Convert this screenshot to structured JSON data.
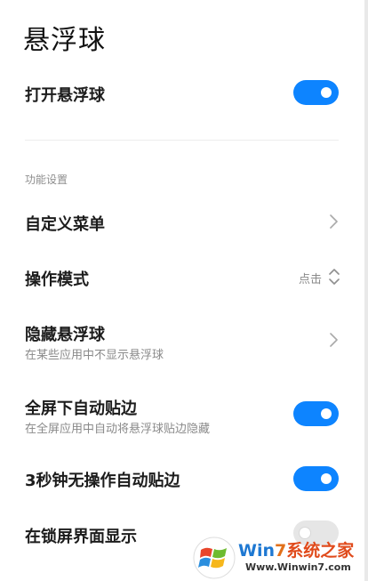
{
  "page": {
    "title": "悬浮球"
  },
  "settings": {
    "enable": {
      "label": "打开悬浮球",
      "enabled": true
    },
    "section_title": "功能设置",
    "custom_menu": {
      "label": "自定义菜单"
    },
    "operation_mode": {
      "label": "操作模式",
      "value": "点击"
    },
    "hide": {
      "label": "隐藏悬浮球",
      "sub": "在某些应用中不显示悬浮球"
    },
    "fullscreen_edge": {
      "label": "全屏下自动贴边",
      "sub": "在全屏应用中自动将悬浮球贴边隐藏",
      "enabled": true
    },
    "idle_edge": {
      "label": "3秒钟无操作自动贴边",
      "enabled": true
    },
    "lockscreen": {
      "label": "在锁屏界面显示",
      "enabled": false
    }
  },
  "watermark": {
    "brand_prefix": "Win",
    "brand_seven": "7",
    "brand_cn": "系统之家",
    "url": "Www.Winwin7.com"
  },
  "colors": {
    "accent": "#0d84ff",
    "toggle_off": "#e6e6e6"
  }
}
